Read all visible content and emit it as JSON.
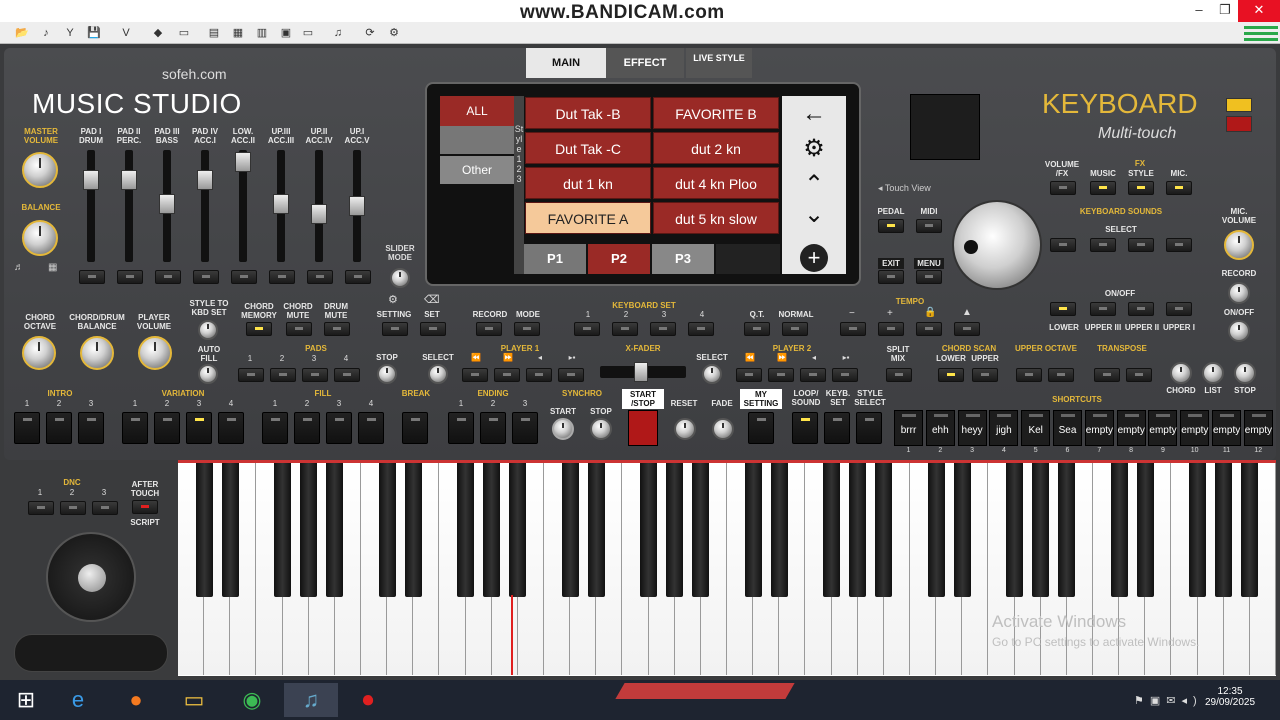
{
  "watermark": "www.BANDICAM.com",
  "brand": {
    "site": "sofeh.com",
    "title": "MUSIC STUDIO",
    "keyboard": "KEYBOARD",
    "subtitle": "Multi-touch",
    "touch_view": "Touch View"
  },
  "tabs": {
    "main": "MAIN",
    "effect": "EFFECT",
    "live_style": "LIVE STYLE"
  },
  "screen": {
    "categories": {
      "all": "ALL",
      "other": "Other"
    },
    "side_label": "Style 1 2 3",
    "styles": [
      [
        "Dut Tak -B",
        "FAVORITE B"
      ],
      [
        "Dut Tak -C",
        "dut 2 kn"
      ],
      [
        "dut 1 kn",
        "dut 4 kn Ploo"
      ],
      [
        "FAVORITE A",
        "dut 5 kn slow"
      ]
    ],
    "pages": [
      "P1",
      "P2",
      "P3"
    ]
  },
  "mixer": {
    "master_volume": "MASTER VOLUME",
    "balance": "BALANCE",
    "channels": [
      "PAD I DRUM",
      "PAD II PERC.",
      "PAD III BASS",
      "PAD IV ACC.I",
      "LOW. ACC.II",
      "UP.III ACC.III",
      "UP.II ACC.IV",
      "UP.I ACC.V"
    ],
    "slider_mode": "SLIDER MODE"
  },
  "controls": {
    "chord_octave": "CHORD OCTAVE",
    "chord_drum_balance": "CHORD/DRUM BALANCE",
    "player_volume": "PLAYER VOLUME",
    "style_to_kbd": "STYLE TO KBD SET",
    "chord_memory": "CHORD MEMORY",
    "chord_mute": "CHORD MUTE",
    "drum_mute": "DRUM MUTE",
    "setting": "SETTING",
    "set": "SET",
    "record": "RECORD",
    "mode": "MODE",
    "keyboard_set": "KEYBOARD SET",
    "qt": "Q.T.",
    "normal": "NORMAL",
    "tempo": "TEMPO",
    "auto_fill": "AUTO FILL",
    "pads": "PADS",
    "stop": "STOP",
    "select": "SELECT",
    "player1": "PLAYER 1",
    "xfader": "X-FADER",
    "player2": "PLAYER 2",
    "split_mix": "SPLIT MIX",
    "chord_scan": "CHORD SCAN",
    "lower": "LOWER",
    "upper": "UPPER",
    "upper_octave": "UPPER OCTAVE",
    "transpose": "TRANSPOSE",
    "chord": "CHORD",
    "list": "LIST",
    "intro": "INTRO",
    "variation": "VARIATION",
    "fill": "FILL",
    "break": "BREAK",
    "ending": "ENDING",
    "synchro": "SYNCHRO",
    "start": "START",
    "start_stop": "START /STOP",
    "reset": "RESET",
    "fade": "FADE",
    "my_setting": "MY SETTING",
    "loop_sound": "LOOP/ SOUND",
    "keyb_set": "KEYB. SET",
    "style_select": "STYLE SELECT",
    "shortcuts": "SHORTCUTS",
    "dnc": "DNC",
    "after_touch": "AFTER TOUCH",
    "script": "SCRIPT",
    "volume_fx": "VOLUME /FX",
    "fx": "FX",
    "music": "MUSIC",
    "style": "STYLE",
    "mic": "MIC.",
    "pedal": "PEDAL",
    "midi": "MIDI",
    "exit": "EXIT",
    "menu": "MENU",
    "keyboard_sounds": "KEYBOARD SOUNDS",
    "ks_select": "SELECT",
    "on_off": "ON/OFF",
    "mic_volume": "MIC. VOLUME",
    "record_r": "RECORD",
    "on_off_r": "ON/OFF",
    "upper_labels": [
      "LOWER",
      "UPPER III",
      "UPPER II",
      "UPPER I"
    ]
  },
  "shortcuts": [
    {
      "label": "brrr",
      "num": "1"
    },
    {
      "label": "ehh",
      "num": "2"
    },
    {
      "label": "heyy",
      "num": "3"
    },
    {
      "label": "jigh",
      "num": "4"
    },
    {
      "label": "Kel",
      "num": "5"
    },
    {
      "label": "Sea",
      "num": "6"
    },
    {
      "label": "empty",
      "num": "7"
    },
    {
      "label": "empty",
      "num": "8"
    },
    {
      "label": "empty",
      "num": "9"
    },
    {
      "label": "empty",
      "num": "10"
    },
    {
      "label": "empty",
      "num": "11"
    },
    {
      "label": "empty",
      "num": "12"
    }
  ],
  "system": {
    "activate_title": "Activate Windows",
    "activate_sub": "Go to PC settings to activate Windows.",
    "time": "12:35",
    "date": "29/09/2025"
  }
}
